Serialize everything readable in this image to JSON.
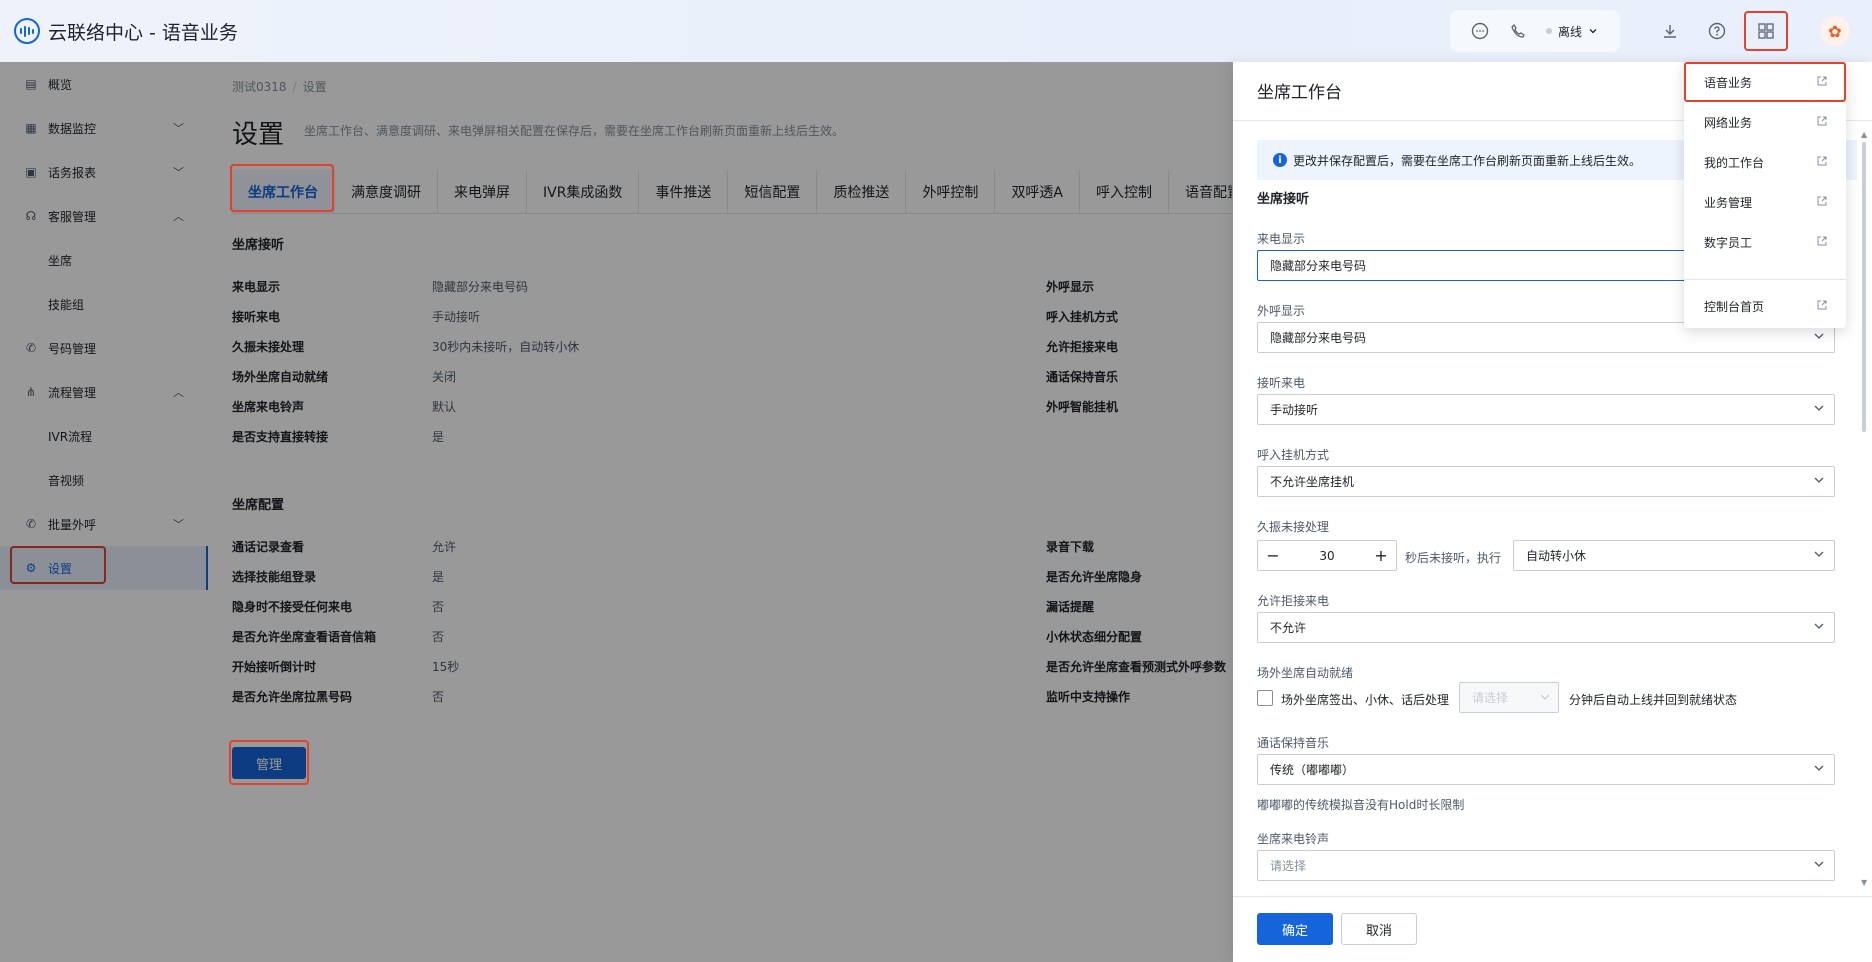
{
  "header": {
    "app_title": "云联络中心 - 语音业务",
    "status_label": "离线"
  },
  "sidebar": {
    "items": [
      {
        "label": "概览",
        "icon": "overview-icon"
      },
      {
        "label": "数据监控",
        "icon": "monitor-icon"
      },
      {
        "label": "话务报表",
        "icon": "report-icon"
      },
      {
        "label": "客服管理",
        "icon": "headset-icon"
      },
      {
        "label": "坐席"
      },
      {
        "label": "技能组"
      },
      {
        "label": "号码管理",
        "icon": "phone-icon"
      },
      {
        "label": "流程管理",
        "icon": "flow-icon"
      },
      {
        "label": "IVR流程"
      },
      {
        "label": "音视频"
      },
      {
        "label": "批量外呼",
        "icon": "batch-call-icon"
      },
      {
        "label": "设置",
        "icon": "gear-icon"
      }
    ]
  },
  "main": {
    "breadcrumb": [
      "测试0318",
      "设置"
    ],
    "title": "设置",
    "description": "坐席工作台、满意度调研、来电弹屏相关配置在保存后，需要在坐席工作台刷新页面重新上线后生效。",
    "tabs": [
      "坐席工作台",
      "满意度调研",
      "来电弹屏",
      "IVR集成函数",
      "事件推送",
      "短信配置",
      "质检推送",
      "外呼控制",
      "双呼透A",
      "呼入控制",
      "语音配置"
    ],
    "section1": {
      "title": "坐席接听",
      "rows": [
        {
          "k": "来电显示",
          "v": "隐藏部分来电号码"
        },
        {
          "k": "接听来电",
          "v": "手动接听"
        },
        {
          "k": "久振未接处理",
          "v": "30秒内未接听，自动转小休"
        },
        {
          "k": "场外坐席自动就绪",
          "v": "关闭"
        },
        {
          "k": "坐席来电铃声",
          "v": "默认"
        },
        {
          "k": "是否支持直接转接",
          "v": "是"
        }
      ],
      "right_keys": [
        "外呼显示",
        "呼入挂机方式",
        "允许拒接来电",
        "通话保持音乐",
        "外呼智能挂机"
      ]
    },
    "section2": {
      "title": "坐席配置",
      "rows": [
        {
          "k": "通话记录查看",
          "v": "允许"
        },
        {
          "k": "选择技能组登录",
          "v": "是"
        },
        {
          "k": "隐身时不接受任何来电",
          "v": "否"
        },
        {
          "k": "是否允许坐席查看语音信箱",
          "v": "否"
        },
        {
          "k": "开始接听倒计时",
          "v": "15秒"
        },
        {
          "k": "是否允许坐席拉黑号码",
          "v": "否"
        }
      ],
      "right_keys": [
        "录音下载",
        "是否允许坐席隐身",
        "漏话提醒",
        "小休状态细分配置",
        "是否允许坐席查看预测式外呼参数",
        "监听中支持操作"
      ]
    },
    "manage_button": "管理"
  },
  "drawer": {
    "title": "坐席工作台",
    "info": "更改并保存配置后，需要在坐席工作台刷新页面重新上线后生效。",
    "section": "坐席接听",
    "fields": {
      "incoming_display": {
        "label": "来电显示",
        "value": "隐藏部分来电号码"
      },
      "outgoing_display": {
        "label": "外呼显示",
        "value": "隐藏部分来电号码"
      },
      "answer_call": {
        "label": "接听来电",
        "value": "手动接听"
      },
      "hangup_mode": {
        "label": "呼入挂机方式",
        "value": "不允许坐席挂机"
      },
      "long_ring": {
        "label": "久振未接处理",
        "seconds": "30",
        "suffix": "秒后未接听，执行",
        "action": "自动转小休"
      },
      "allow_reject": {
        "label": "允许拒接来电",
        "value": "不允许"
      },
      "auto_ready": {
        "label": "场外坐席自动就绪",
        "checkbox_text": "场外坐席签出、小休、话后处理",
        "placeholder": "请选择",
        "tail": "分钟后自动上线并回到就绪状态"
      },
      "hold_music": {
        "label": "通话保持音乐",
        "value": "传统（嘟嘟嘟）",
        "hint": "嘟嘟嘟的传统模拟音没有Hold时长限制"
      },
      "ringtone": {
        "label": "坐席来电铃声",
        "placeholder": "请选择"
      }
    },
    "ok": "确定",
    "cancel": "取消"
  },
  "dropdown": {
    "items": [
      "语音业务",
      "网络业务",
      "我的工作台",
      "业务管理",
      "数字员工",
      "控制台首页"
    ]
  },
  "colors": {
    "primary": "#1664d9",
    "highlight": "#e0442f"
  }
}
